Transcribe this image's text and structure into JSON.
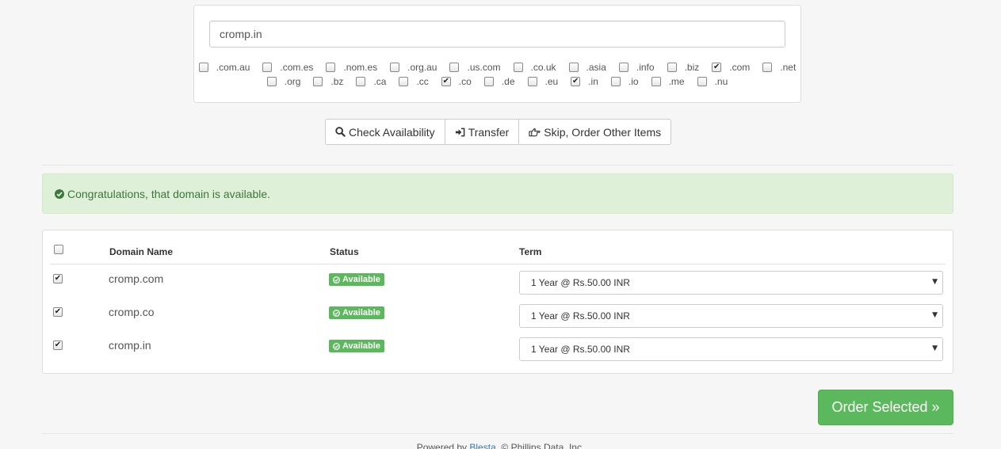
{
  "search": {
    "value": "cromp.in",
    "placeholder": ""
  },
  "tlds_row1": [
    {
      "label": ".com.au",
      "checked": false
    },
    {
      "label": ".com.es",
      "checked": false
    },
    {
      "label": ".nom.es",
      "checked": false
    },
    {
      "label": ".org.au",
      "checked": false
    },
    {
      "label": ".us.com",
      "checked": false
    },
    {
      "label": ".co.uk",
      "checked": false
    },
    {
      "label": ".asia",
      "checked": false
    },
    {
      "label": ".info",
      "checked": false
    },
    {
      "label": ".biz",
      "checked": false
    },
    {
      "label": ".com",
      "checked": true
    },
    {
      "label": ".net",
      "checked": false
    }
  ],
  "tlds_row2": [
    {
      "label": ".org",
      "checked": false
    },
    {
      "label": ".bz",
      "checked": false
    },
    {
      "label": ".ca",
      "checked": false
    },
    {
      "label": ".cc",
      "checked": false
    },
    {
      "label": ".co",
      "checked": true
    },
    {
      "label": ".de",
      "checked": false
    },
    {
      "label": ".eu",
      "checked": false
    },
    {
      "label": ".in",
      "checked": true
    },
    {
      "label": ".io",
      "checked": false
    },
    {
      "label": ".me",
      "checked": false
    },
    {
      "label": ".nu",
      "checked": false
    }
  ],
  "actions": {
    "check_label": "Check Availability",
    "transfer_label": "Transfer",
    "skip_label": "Skip, Order Other Items"
  },
  "alert": {
    "text": "Congratulations, that domain is available."
  },
  "table": {
    "headers": {
      "domain": "Domain Name",
      "status": "Status",
      "term": "Term"
    },
    "select_all_checked": false,
    "rows": [
      {
        "domain": "cromp.com",
        "status": "Available",
        "term": "1 Year @ Rs.50.00 INR",
        "checked": true
      },
      {
        "domain": "cromp.co",
        "status": "Available",
        "term": "1 Year @ Rs.50.00 INR",
        "checked": true
      },
      {
        "domain": "cromp.in",
        "status": "Available",
        "term": "1 Year @ Rs.50.00 INR",
        "checked": true
      }
    ]
  },
  "order": {
    "label": "Order Selected »"
  },
  "footer": {
    "prefix": "Powered by ",
    "link": "Blesta",
    "suffix": ", © Phillips Data, Inc."
  },
  "colors": {
    "success": "#5cb85c",
    "alert_bg": "#dff0d8",
    "alert_text": "#3c763d",
    "link": "#337ab7"
  },
  "icons": {
    "check": "search-icon",
    "transfer": "sign-in-icon",
    "skip": "hand-point-right-icon",
    "alert": "check-circle-icon"
  }
}
